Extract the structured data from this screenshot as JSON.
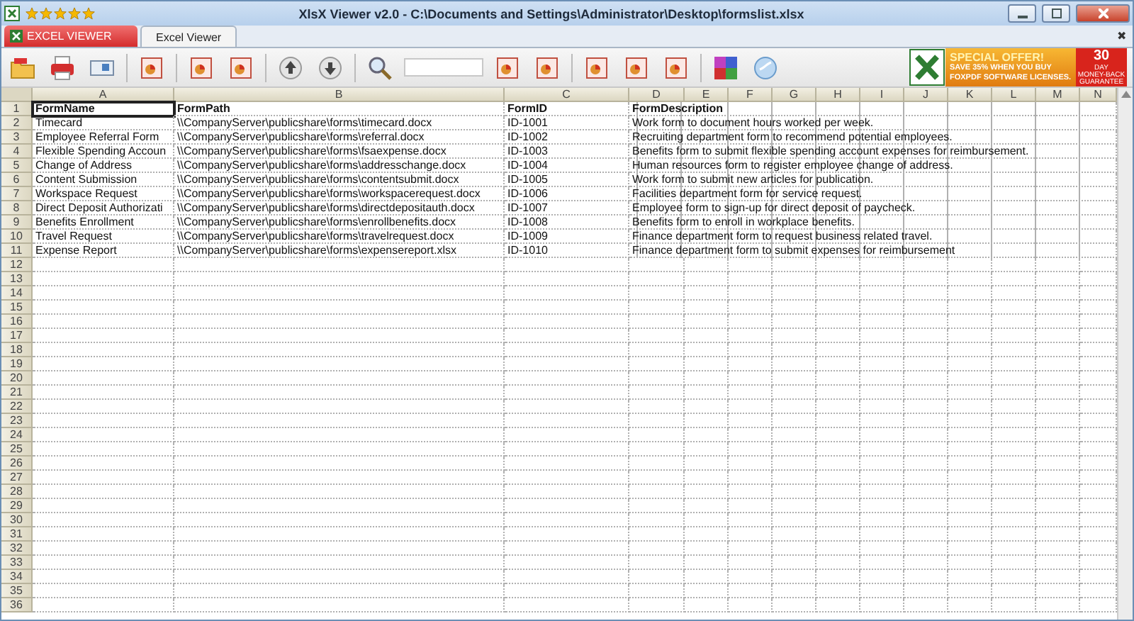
{
  "title_bar": {
    "stars": 5,
    "title": "XlsX Viewer v2.0 - C:\\Documents and Settings\\Administrator\\Desktop\\formslist.xlsx"
  },
  "ribbon": {
    "app_button": "EXCEL VIEWER",
    "tabs": [
      {
        "label": "Excel Viewer",
        "selected": true
      }
    ],
    "close": "✖"
  },
  "ad": {
    "headline": "SPECIAL OFFER!",
    "line_1": "SAVE 35% WHEN YOU BUY",
    "line_2": "FOXPDF SOFTWARE LICENSES.",
    "days": "30",
    "day_label": "DAY",
    "guarantee": "MONEY-BACK GUARANTEE"
  },
  "sheet": {
    "columns": [
      "A",
      "B",
      "C",
      "D",
      "E",
      "F",
      "G",
      "H",
      "I",
      "J",
      "K",
      "L",
      "M",
      "N"
    ],
    "rows": [
      {
        "number": "1",
        "cells": [
          {
            "text": "FormName",
            "selected": true
          },
          {
            "text": "FormPath",
            "selected": false
          },
          {
            "text": "FormID",
            "selected": false
          },
          {
            "text": "FormDescription",
            "selected": false
          }
        ]
      },
      {
        "number": "2",
        "cells": [
          {
            "text": "Timecard",
            "selected": false
          },
          {
            "text": "\\\\CompanyServer\\publicshare\\forms\\timecard.docx",
            "selected": false
          },
          {
            "text": "ID-1001",
            "selected": false
          },
          {
            "text": "Work form to document hours worked per week.",
            "selected": false
          }
        ]
      },
      {
        "number": "3",
        "cells": [
          {
            "text": "Employee Referral Form",
            "selected": false
          },
          {
            "text": "\\\\CompanyServer\\publicshare\\forms\\referral.docx",
            "selected": false
          },
          {
            "text": "ID-1002",
            "selected": false
          },
          {
            "text": "Recruiting department form to recommend potential employees.",
            "selected": false
          }
        ]
      },
      {
        "number": "4",
        "cells": [
          {
            "text": "Flexible Spending Accoun",
            "selected": false
          },
          {
            "text": "\\\\CompanyServer\\publicshare\\forms\\fsaexpense.docx",
            "selected": false
          },
          {
            "text": "ID-1003",
            "selected": false
          },
          {
            "text": "Benefits form to submit flexible spending account expenses for reimbursement.",
            "selected": false
          }
        ]
      },
      {
        "number": "5",
        "cells": [
          {
            "text": "Change of Address",
            "selected": false
          },
          {
            "text": "\\\\CompanyServer\\publicshare\\forms\\addresschange.docx",
            "selected": false
          },
          {
            "text": "ID-1004",
            "selected": false
          },
          {
            "text": "Human resources form to register employee change of address.",
            "selected": false
          }
        ]
      },
      {
        "number": "6",
        "cells": [
          {
            "text": "Content Submission",
            "selected": false
          },
          {
            "text": "\\\\CompanyServer\\publicshare\\forms\\contentsubmit.docx",
            "selected": false
          },
          {
            "text": "ID-1005",
            "selected": false
          },
          {
            "text": "Work form to submit new articles for publication.",
            "selected": false
          }
        ]
      },
      {
        "number": "7",
        "cells": [
          {
            "text": "Workspace Request",
            "selected": false
          },
          {
            "text": "\\\\CompanyServer\\publicshare\\forms\\workspacerequest.docx",
            "selected": false
          },
          {
            "text": "ID-1006",
            "selected": false
          },
          {
            "text": "Facilities department form for service request.",
            "selected": false
          }
        ]
      },
      {
        "number": "8",
        "cells": [
          {
            "text": "Direct Deposit Authorizati",
            "selected": false
          },
          {
            "text": "\\\\CompanyServer\\publicshare\\forms\\directdepositauth.docx",
            "selected": false
          },
          {
            "text": "ID-1007",
            "selected": false
          },
          {
            "text": "Employee form to sign-up for direct deposit of paycheck.",
            "selected": false
          }
        ]
      },
      {
        "number": "9",
        "cells": [
          {
            "text": "Benefits Enrollment",
            "selected": false
          },
          {
            "text": "\\\\CompanyServer\\publicshare\\forms\\enrollbenefits.docx",
            "selected": false
          },
          {
            "text": "ID-1008",
            "selected": false
          },
          {
            "text": "Benefits form to enroll in workplace benefits.",
            "selected": false
          }
        ]
      },
      {
        "number": "10",
        "cells": [
          {
            "text": "Travel Request",
            "selected": false
          },
          {
            "text": "\\\\CompanyServer\\publicshare\\forms\\travelrequest.docx",
            "selected": false
          },
          {
            "text": "ID-1009",
            "selected": false
          },
          {
            "text": "Finance department form to request business related travel.",
            "selected": false
          }
        ]
      },
      {
        "number": "11",
        "cells": [
          {
            "text": "Expense Report",
            "selected": false
          },
          {
            "text": "\\\\CompanyServer\\publicshare\\forms\\expensereport.xlsx",
            "selected": false
          },
          {
            "text": "ID-1010",
            "selected": false
          },
          {
            "text": "Finance department form to submit expenses for reimbursement",
            "selected": false
          }
        ]
      },
      {
        "number": "12"
      },
      {
        "number": "13"
      },
      {
        "number": "14"
      },
      {
        "number": "15"
      },
      {
        "number": "16"
      },
      {
        "number": "17"
      },
      {
        "number": "18"
      },
      {
        "number": "19"
      },
      {
        "number": "20"
      },
      {
        "number": "21"
      },
      {
        "number": "22"
      },
      {
        "number": "23"
      },
      {
        "number": "24"
      },
      {
        "number": "25"
      },
      {
        "number": "26"
      },
      {
        "number": "27"
      },
      {
        "number": "28"
      },
      {
        "number": "29"
      },
      {
        "number": "30"
      },
      {
        "number": "31"
      },
      {
        "number": "32"
      },
      {
        "number": "33"
      },
      {
        "number": "34"
      },
      {
        "number": "35"
      },
      {
        "number": "36"
      }
    ]
  }
}
